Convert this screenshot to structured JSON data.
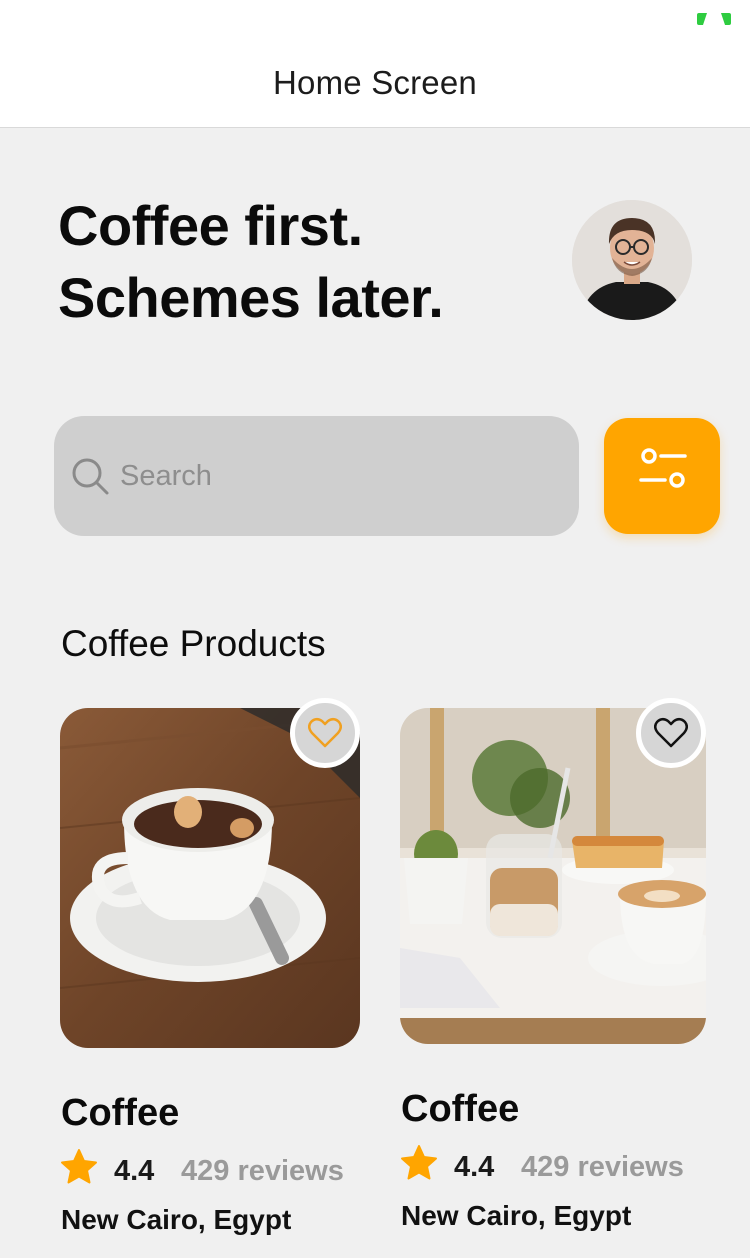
{
  "screen": {
    "title": "Home Screen",
    "headline": [
      "Coffee first.",
      "Schemes later."
    ]
  },
  "search": {
    "placeholder": "Search"
  },
  "products": {
    "section_title": "Coffee Products",
    "items": [
      {
        "title": "Coffee",
        "rating": "4.4",
        "reviews": "429 reviews",
        "location": "New Cairo, Egypt",
        "heart_icon": "heart-outline-icon",
        "heart_color": "#f0a020"
      },
      {
        "title": "Coffee",
        "rating": "4.4",
        "reviews": "429 reviews",
        "location": "New Cairo, Egypt",
        "heart_icon": "heart-outline-icon",
        "heart_color": "#111111"
      }
    ]
  },
  "colors": {
    "accent": "#ffa500",
    "star": "#ffa500",
    "status_indicator": "#2ecc40"
  }
}
